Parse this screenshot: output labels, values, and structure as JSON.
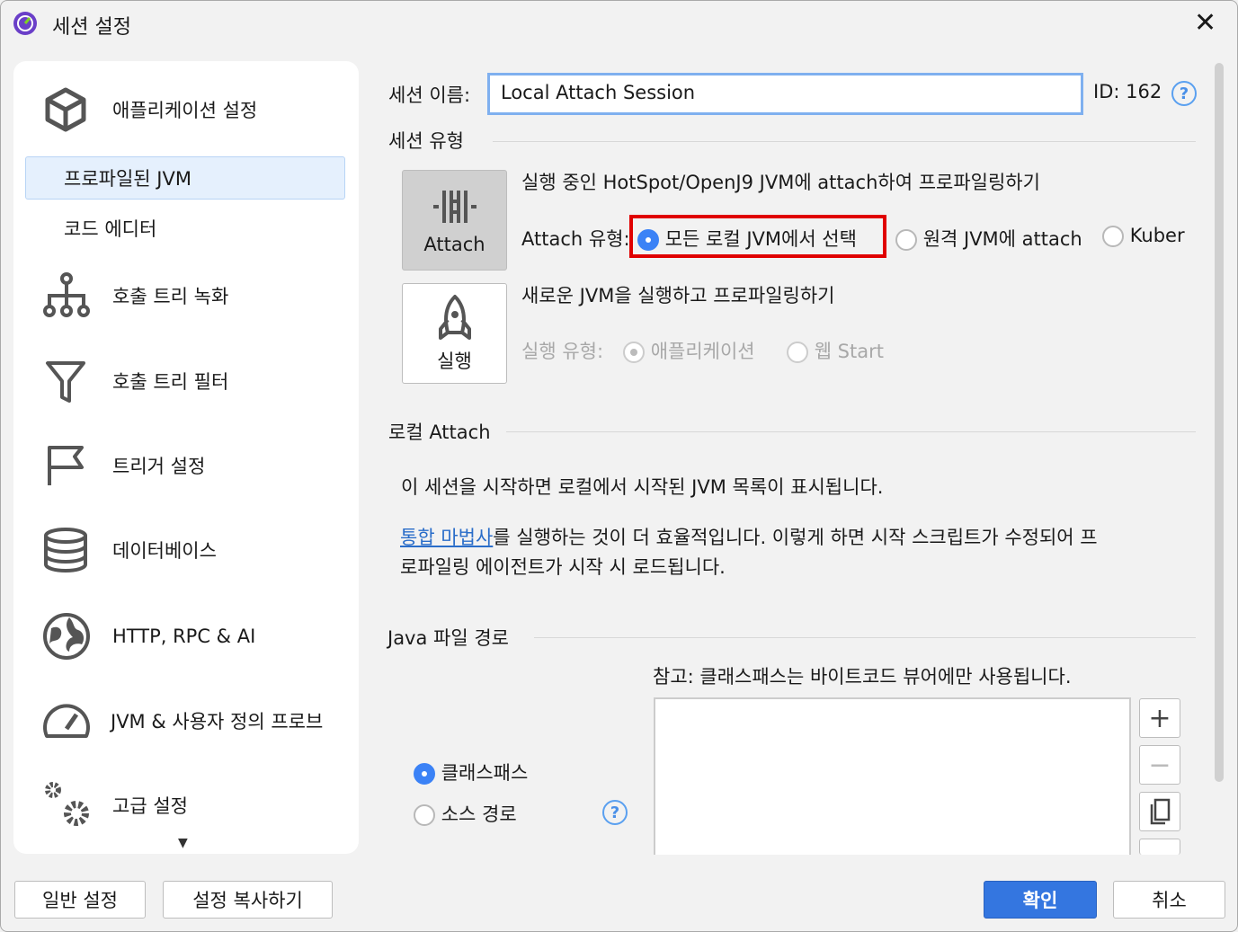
{
  "title": "세션 설정",
  "sidebar": {
    "items": [
      {
        "label": "애플리케이션 설정"
      },
      {
        "label": "프로파일된 JVM"
      },
      {
        "label": "코드 에디터"
      },
      {
        "label": "호출 트리 녹화"
      },
      {
        "label": "호출 트리 필터"
      },
      {
        "label": "트리거 설정"
      },
      {
        "label": "데이터베이스"
      },
      {
        "label": "HTTP, RPC & AI"
      },
      {
        "label": "JVM & 사용자 정의 프로브"
      },
      {
        "label": "고급 설정"
      }
    ]
  },
  "session": {
    "name_label": "세션 이름:",
    "name_value": "Local Attach Session",
    "id_label": "ID:",
    "id_value": "162"
  },
  "type": {
    "section": "세션 유형",
    "attach_label": "Attach",
    "attach_desc": "실행 중인 HotSpot/OpenJ9 JVM에 attach하여 프로파일링하기",
    "attach_type_label": "Attach 유형:",
    "attach_options": [
      "모든 로컬 JVM에서 선택",
      "원격 JVM에 attach",
      "Kuber"
    ],
    "launch_label": "실행",
    "launch_desc": "새로운 JVM을 실행하고 프로파일링하기",
    "launch_type_label": "실행 유형:",
    "launch_options": [
      "애플리케이션",
      "웹 Start"
    ]
  },
  "local": {
    "section": "로컬 Attach",
    "info": "이 세션을 시작하면 로컬에서 시작된 JVM 목록이 표시됩니다.",
    "link": "통합 마법사",
    "text1": "를 실행하는 것이 더 효율적입니다. 이렇게 하면 시작 스크립트가 수정되어 프",
    "text2": "로파일링 에이전트가 시작 시 로드됩니다."
  },
  "java": {
    "section": "Java 파일 경로",
    "note": "참고: 클래스패스는 바이트코드 뷰어에만 사용됩니다.",
    "options": [
      "클래스패스",
      "소스 경로"
    ]
  },
  "footer": {
    "general": "일반 설정",
    "copy": "설정 복사하기",
    "ok": "확인",
    "cancel": "취소"
  },
  "colors": {
    "accent": "#3b82f6",
    "highlight": "#e00000"
  }
}
